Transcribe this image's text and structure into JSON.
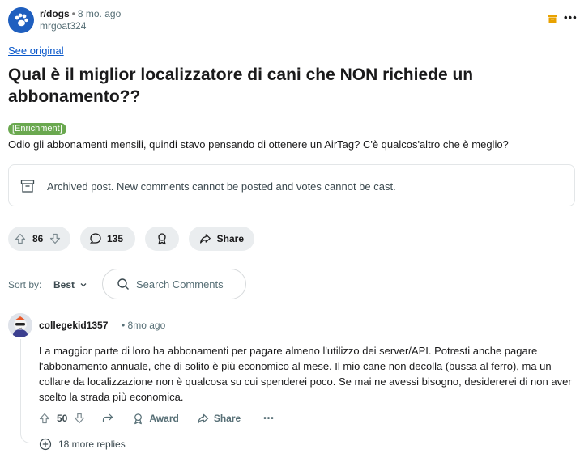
{
  "post": {
    "subreddit": "r/dogs",
    "separator": "•",
    "age": "8 mo. ago",
    "author": "mrgoat324",
    "see_original": "See original",
    "title": "Qual è il miglior localizzatore di cani che NON richiede un abbonamento??",
    "flair": "[Enrichment]",
    "body": "Odio gli abbonamenti mensili, quindi stavo pensando di ottenere un AirTag? C'è qualcos'altro che è meglio?",
    "more_glyph": "•••"
  },
  "archived": {
    "text": "Archived post. New comments cannot be posted and votes cannot be cast."
  },
  "actions": {
    "votes": "86",
    "comments": "135",
    "share": "Share"
  },
  "sort": {
    "label": "Sort by:",
    "value": "Best",
    "search_placeholder": "Search Comments"
  },
  "comment": {
    "user": "collegekid1357",
    "separator": "•",
    "age": "8mo ago",
    "body": "La maggior parte di loro ha abbonamenti per pagare almeno l'utilizzo dei server/API. Potresti anche pagare l'abbonamento annuale, che di solito è più economico al mese. Il mio cane non decolla (bussa al ferro), ma un collare da localizzazione non è qualcosa su cui spenderei poco. Se mai ne avessi bisogno, desidererei di non aver scelto la strada più economica.",
    "votes": "50",
    "award": "Award",
    "share": "Share",
    "more": "•••",
    "more_replies": "18 more replies"
  },
  "colors": {
    "subreddit_icon": "#1f5fbf",
    "archive_icon": "#e8a200",
    "flair_bg": "#6aa84f",
    "link": "#0a58ca"
  }
}
